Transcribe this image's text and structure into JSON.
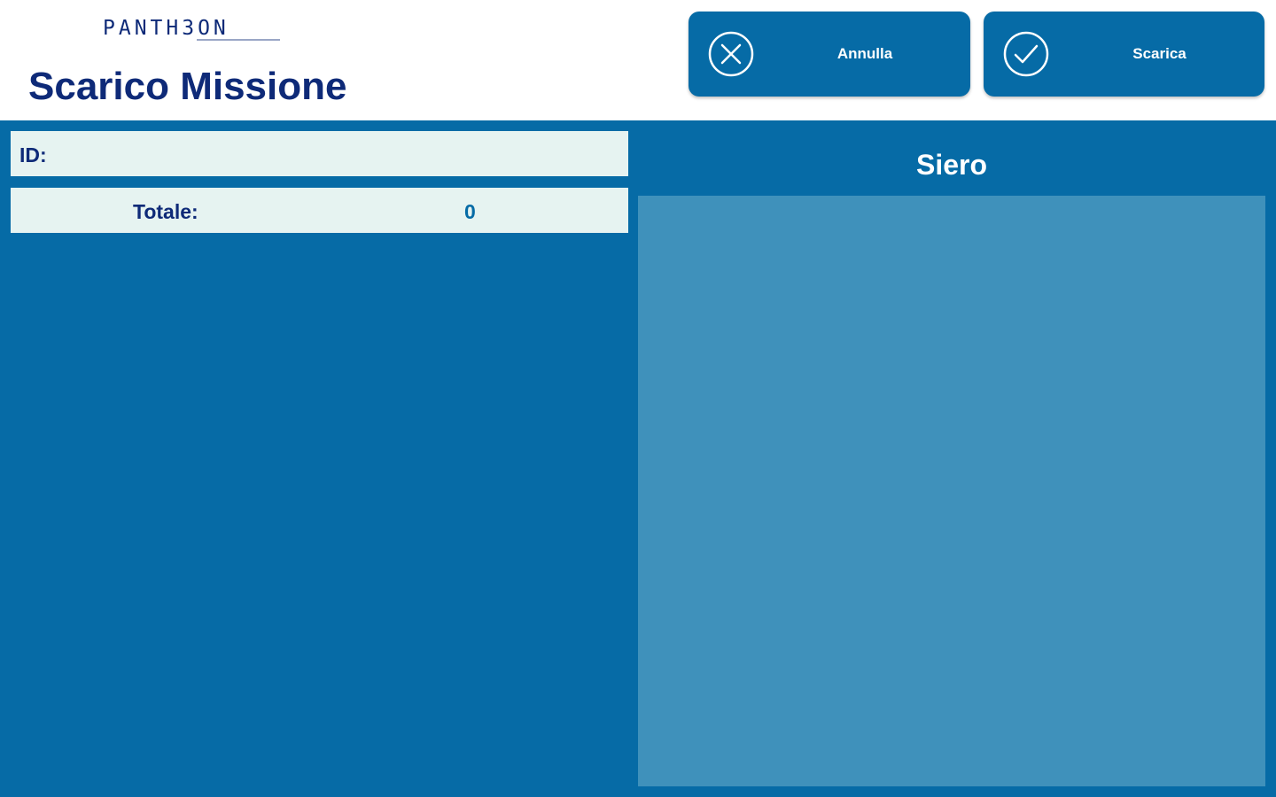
{
  "header": {
    "logo_text": "PANTH3ON",
    "title": "Scarico Missione"
  },
  "toolbar": {
    "cancel_label": "Annulla",
    "cancel_icon": "close-circle-icon",
    "confirm_label": "Scarica",
    "confirm_icon": "check-circle-icon"
  },
  "form": {
    "id_label": "ID:",
    "id_value": "",
    "total_label": "Totale:",
    "total_value": "0"
  },
  "panel": {
    "title": "Siero"
  },
  "colors": {
    "primary_blue": "#066ba6",
    "panel_blue": "#3f91bb",
    "title_navy": "#0e2a78",
    "field_bg": "#e6f3f1"
  }
}
